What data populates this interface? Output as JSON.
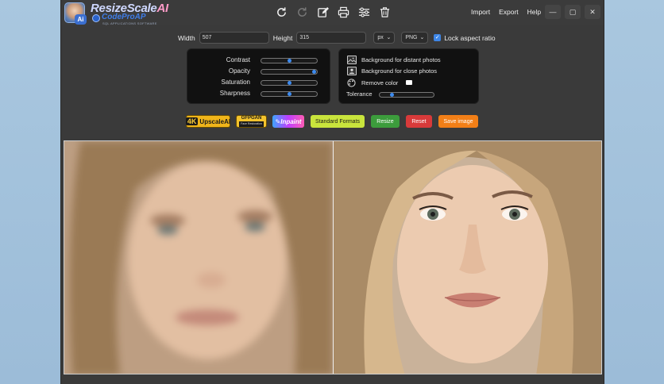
{
  "app": {
    "logo_title_main": "ResizeScale",
    "logo_title_ai": "AI",
    "logo_avatar_badge": "Ai",
    "logo_brand": "CodeProAP",
    "logo_tagline": "SQL APPLICATIONS SOFTWARE"
  },
  "toolbar": {
    "icons": [
      "rotate-cw-icon",
      "redo-icon",
      "edit-icon",
      "print-icon",
      "sliders-icon",
      "trash-icon"
    ]
  },
  "menu": {
    "import": "Import",
    "export": "Export",
    "help": "Help"
  },
  "window_controls": {
    "minimize": "—",
    "maximize": "▢",
    "close": "✕"
  },
  "dimensions": {
    "width_label": "Width",
    "width_value": "507",
    "height_label": "Height",
    "height_value": "315",
    "unit": "px",
    "format": "PNG",
    "lock_label": "Lock aspect ratio",
    "lock_checked": true
  },
  "adjustments": [
    {
      "label": "Contrast",
      "value": 0.5
    },
    {
      "label": "Opacity",
      "value": 0.97
    },
    {
      "label": "Saturation",
      "value": 0.5
    },
    {
      "label": "Sharpness",
      "value": 0.5
    }
  ],
  "background_options": {
    "distant": "Background for distant photos",
    "close": "Background for close photos",
    "remove_color": "Remove color",
    "remove_color_swatch": "#ffffff",
    "tolerance_label": "Tolerance",
    "tolerance_value": 0.25
  },
  "actions": {
    "upscale_tag": "4K",
    "upscale_label": "UpscaleAI",
    "gfpgan_label": "GFPGAN",
    "gfpgan_sub": "Face Restoration",
    "inpaint_label": "Inpaint",
    "standard_formats": "Standard Formats",
    "resize": "Resize",
    "reset": "Reset",
    "save_image": "Save image"
  },
  "colors": {
    "accent": "#3d8bf0",
    "resize": "#3c9c3c",
    "reset": "#d83a3a",
    "save": "#f27f17",
    "standard": "#c9e43c",
    "upscale": "#f0b51a"
  }
}
